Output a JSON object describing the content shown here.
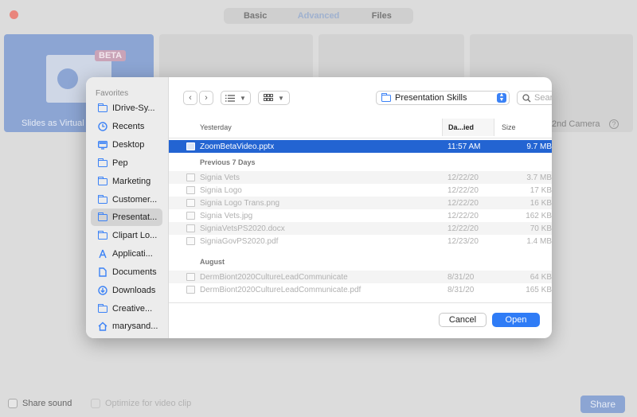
{
  "background": {
    "tabs": [
      "Basic",
      "Advanced",
      "Files"
    ],
    "active_tab": "Advanced",
    "tile_beta": "BETA",
    "tile_caption": "Slides as Virtual",
    "second_camera": "2nd Camera",
    "help": "?",
    "share_sound": "Share sound",
    "optimize": "Optimize for video clip",
    "share_button": "Share"
  },
  "dialog": {
    "sidebar": {
      "section": "Favorites",
      "items": [
        {
          "label": "IDrive-Sy...",
          "icon": "folder"
        },
        {
          "label": "Recents",
          "icon": "clock"
        },
        {
          "label": "Desktop",
          "icon": "desktop"
        },
        {
          "label": "Pep",
          "icon": "folder"
        },
        {
          "label": "Marketing",
          "icon": "folder"
        },
        {
          "label": "Customer...",
          "icon": "folder"
        },
        {
          "label": "Presentat...",
          "icon": "folder",
          "selected": true
        },
        {
          "label": "Clipart Lo...",
          "icon": "folder"
        },
        {
          "label": "Applicati...",
          "icon": "apps"
        },
        {
          "label": "Documents",
          "icon": "doc"
        },
        {
          "label": "Downloads",
          "icon": "download"
        },
        {
          "label": "Creative...",
          "icon": "folder"
        },
        {
          "label": "marysand...",
          "icon": "home"
        }
      ]
    },
    "toolbar": {
      "location": "Presentation Skills",
      "search_placeholder": "Search"
    },
    "columns": {
      "name": "Yesterday",
      "date": "Da...ied",
      "size": "Size"
    },
    "groups": [
      "Previous 7 Days",
      "August"
    ],
    "files": [
      {
        "name": "ZoomBetaVideo.pptx",
        "date": "11:57 AM",
        "size": "9.7 MB",
        "selected": true
      },
      {
        "name": "Signia Vets",
        "date": "12/22/20",
        "size": "3.7 MB"
      },
      {
        "name": "Signia Logo",
        "date": "12/22/20",
        "size": "17 KB"
      },
      {
        "name": "Signia Logo Trans.png",
        "date": "12/22/20",
        "size": "16 KB"
      },
      {
        "name": "Signia Vets.jpg",
        "date": "12/22/20",
        "size": "162 KB"
      },
      {
        "name": "SigniaVetsPS2020.docx",
        "date": "12/22/20",
        "size": "70 KB"
      },
      {
        "name": "SigniaGovPS2020.pdf",
        "date": "12/23/20",
        "size": "1.4 MB"
      },
      {
        "name": "DermBiont2020CultureLeadCommunicate",
        "date": "8/31/20",
        "size": "64 KB"
      },
      {
        "name": "DermBiont2020CultureLeadCommunicate.pdf",
        "date": "8/31/20",
        "size": "165 KB"
      }
    ],
    "cancel": "Cancel",
    "open": "Open"
  },
  "colors": {
    "accent": "#2f7cf6",
    "selection": "#2364d2",
    "dim_accent": "#8ca5d3"
  }
}
